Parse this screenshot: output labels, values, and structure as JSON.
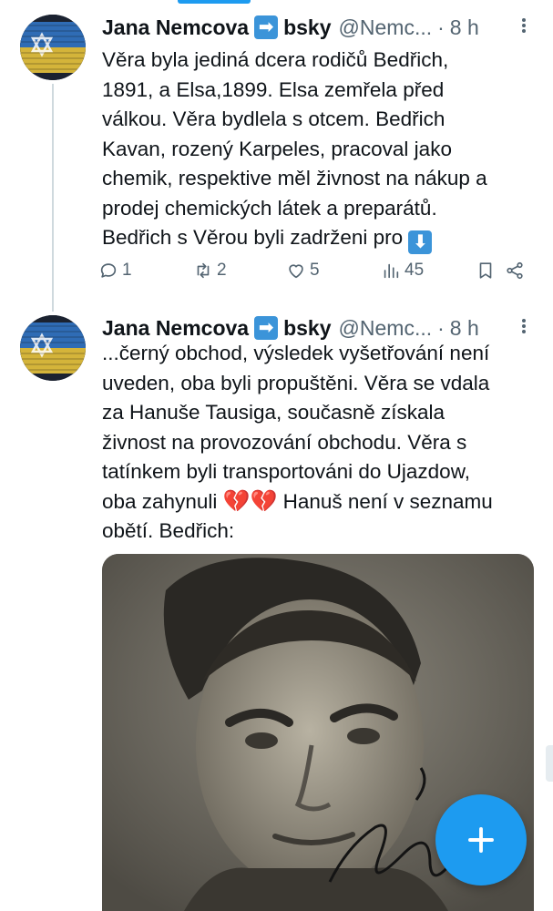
{
  "tweets": [
    {
      "author_name": "Jana Nemcova",
      "author_suffix": "bsky",
      "arrow_emoji": "➡",
      "handle": "@Nemc...",
      "separator": "·",
      "time": "8 h",
      "text_lines": [
        "Věra byla jediná dcera rodičů Bedřich,",
        "1891, a Elsa,1899. Elsa zemřela před",
        "válkou. Věra bydlela s otcem. Bedřich",
        "Kavan, rozený Karpeles, pracoval jako",
        "chemik, respektive měl živnost na nákup a",
        "prodej chemických látek a preparátů.",
        "Bedřich s Věrou byli zadrženi pro"
      ],
      "trailing_emoji": "⬇",
      "replies": "1",
      "retweets": "2",
      "likes": "5",
      "views": "45"
    },
    {
      "author_name": "Jana Nemcova",
      "author_suffix": "bsky",
      "arrow_emoji": "➡",
      "handle": "@Nemc...",
      "separator": "·",
      "time": "8 h",
      "text_lines": [
        "...černý obchod, výsledek vyšetřování není",
        "uveden, oba byli propuštěni. Věra se vdala",
        "za Hanuše Tausiga, současně získala",
        "živnost na provozování obchodu.  Věra s",
        "tatínkem byli transportováni do Ujazdow,",
        "oba zahynuli",
        "obětí.  Bedřich:"
      ],
      "hearts_emoji": "💔💔",
      "line6_tail": " Hanuš není v seznamu"
    }
  ],
  "icons": {
    "reply": "reply-icon",
    "retweet": "retweet-icon",
    "like": "heart-icon",
    "views": "views-icon",
    "bookmark": "bookmark-icon",
    "share": "share-icon",
    "compose": "plus-icon"
  },
  "colors": {
    "accent": "#1d9bf0",
    "text": "#0f1419",
    "muted": "#536471"
  }
}
